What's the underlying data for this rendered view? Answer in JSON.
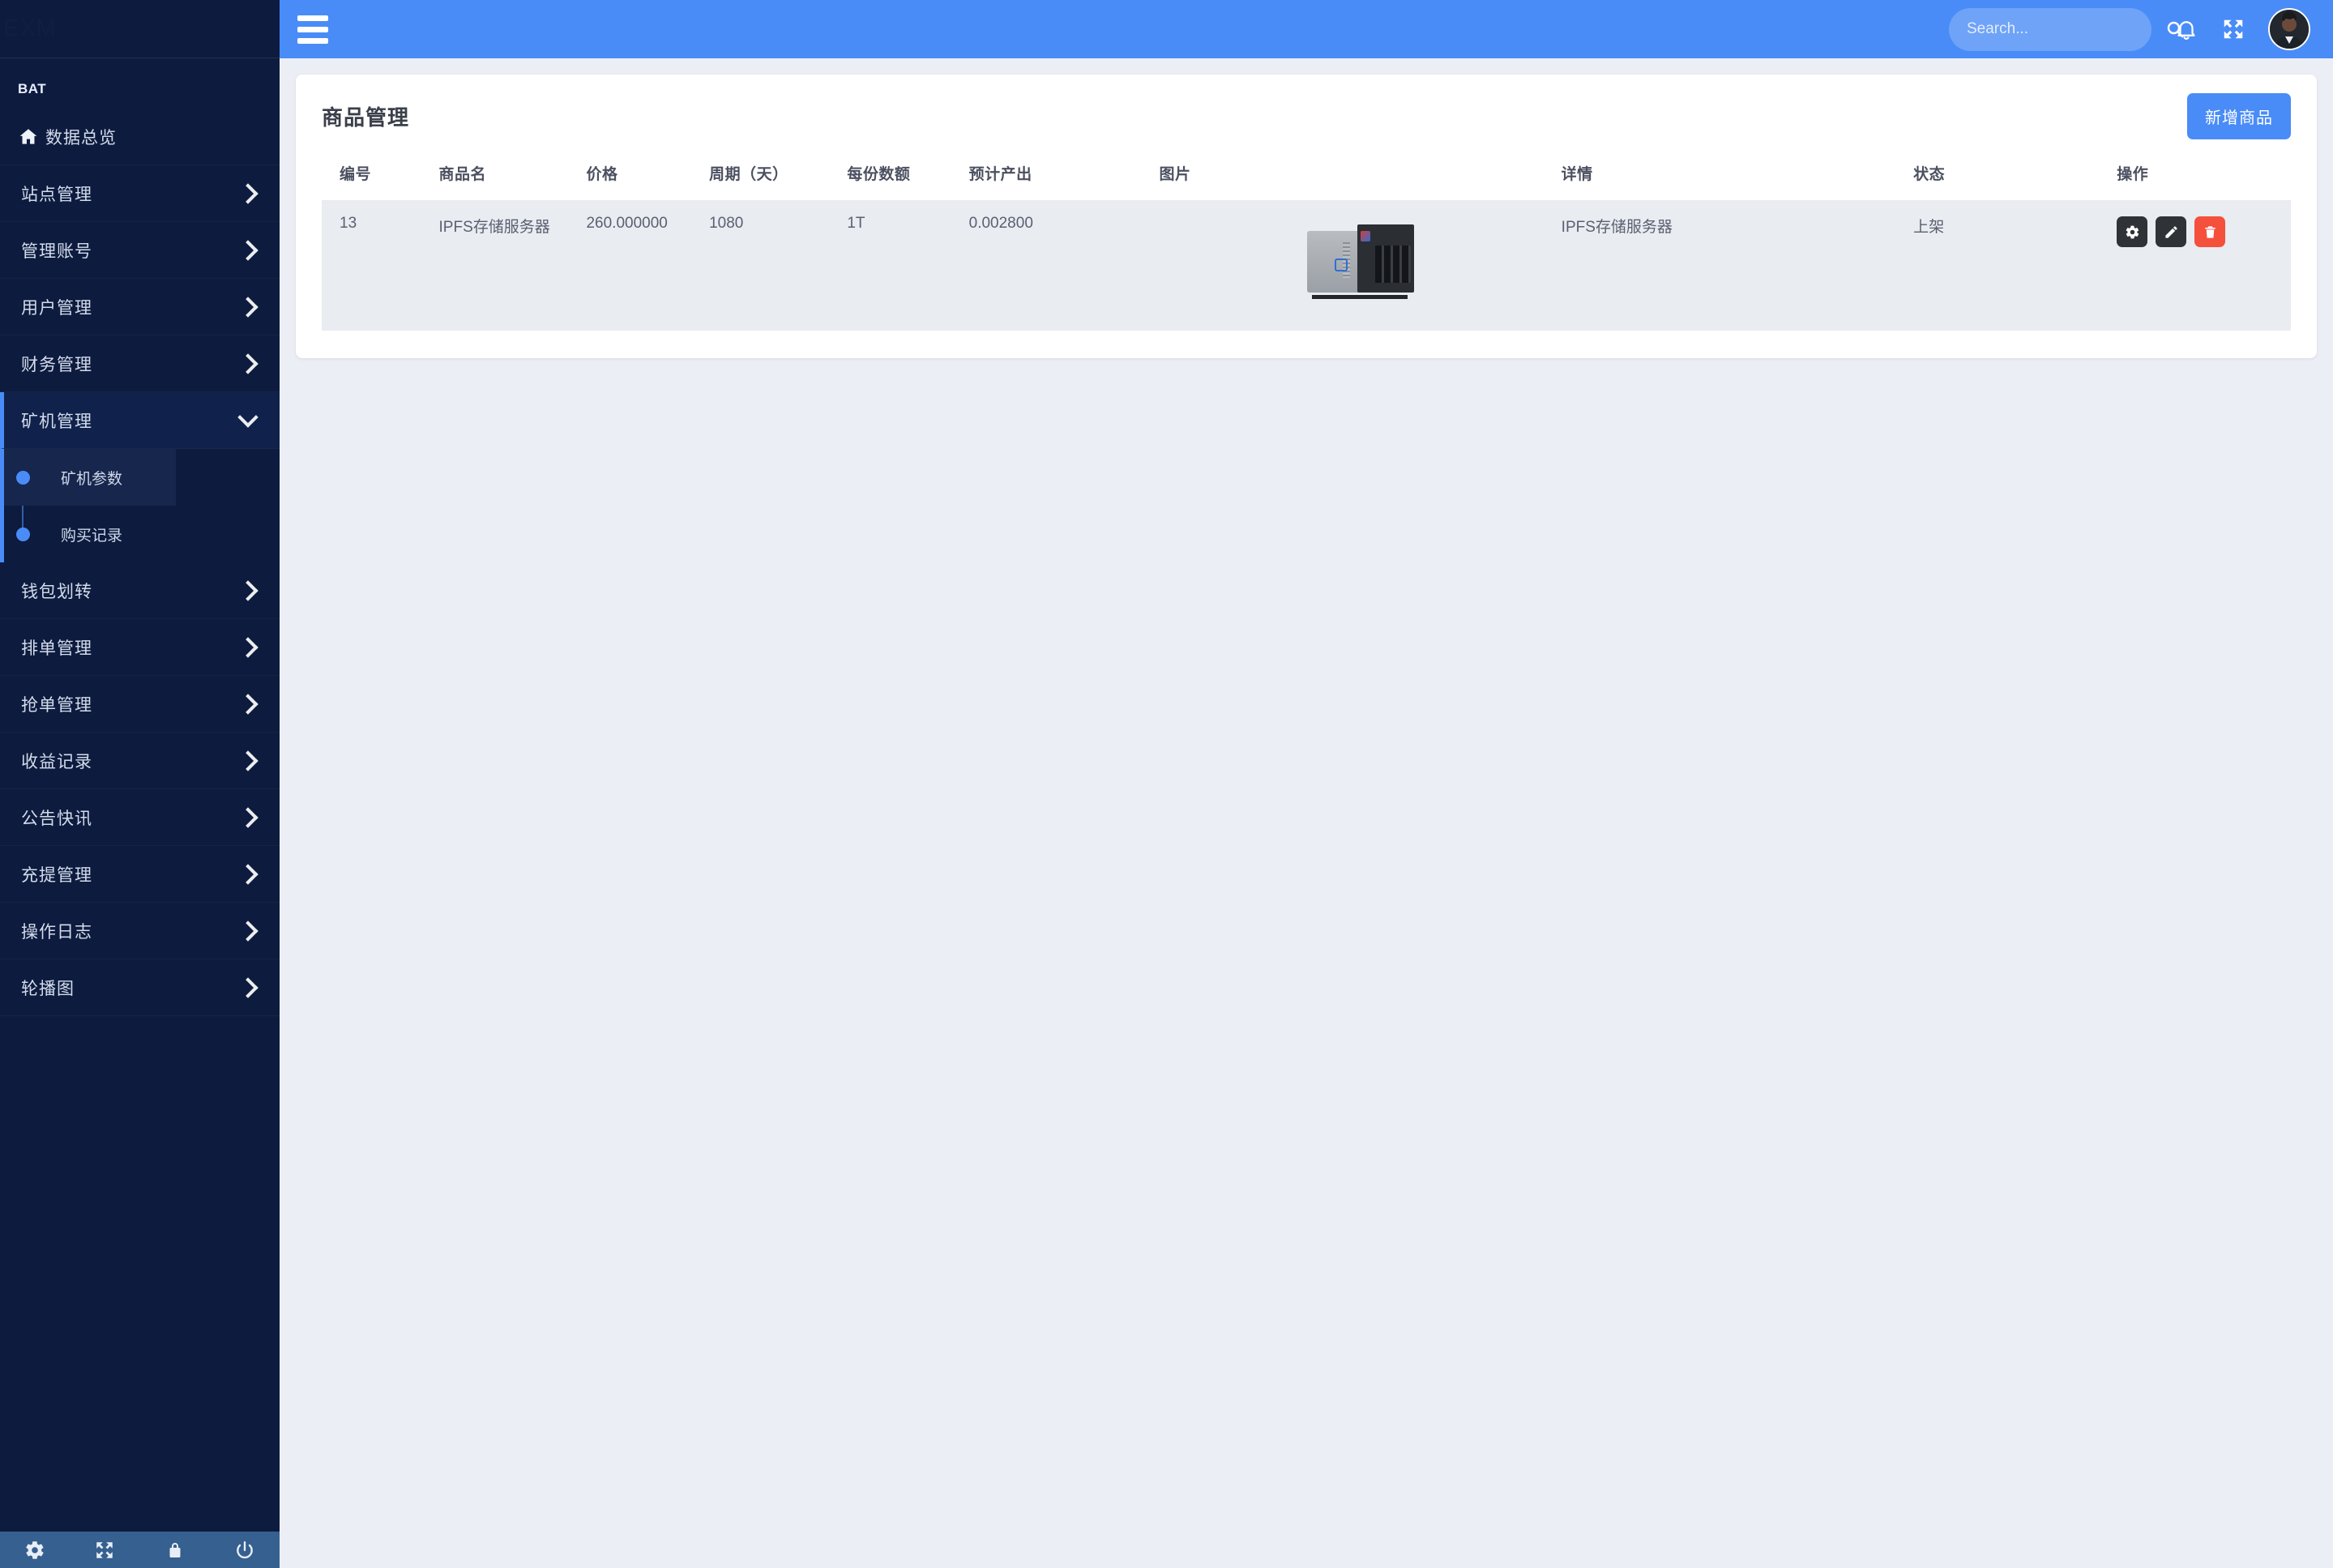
{
  "brand": {
    "logo_text": "EXM",
    "section_title": "BAT"
  },
  "sidebar": {
    "items": [
      {
        "label": "数据总览",
        "icon": "home-icon",
        "has_chevron": false,
        "state": "normal"
      },
      {
        "label": "站点管理",
        "icon": "chevron-right-icon",
        "has_chevron": true,
        "state": "normal"
      },
      {
        "label": "管理账号",
        "icon": "chevron-right-icon",
        "has_chevron": true,
        "state": "normal"
      },
      {
        "label": "用户管理",
        "icon": "chevron-right-icon",
        "has_chevron": true,
        "state": "normal"
      },
      {
        "label": "财务管理",
        "icon": "chevron-right-icon",
        "has_chevron": true,
        "state": "normal"
      },
      {
        "label": "矿机管理",
        "icon": "chevron-down-icon",
        "has_chevron": true,
        "state": "expanded"
      },
      {
        "label": "钱包划转",
        "icon": "chevron-right-icon",
        "has_chevron": true,
        "state": "normal"
      },
      {
        "label": "排单管理",
        "icon": "chevron-right-icon",
        "has_chevron": true,
        "state": "normal"
      },
      {
        "label": "抢单管理",
        "icon": "chevron-right-icon",
        "has_chevron": true,
        "state": "normal"
      },
      {
        "label": "收益记录",
        "icon": "chevron-right-icon",
        "has_chevron": true,
        "state": "normal"
      },
      {
        "label": "公告快讯",
        "icon": "chevron-right-icon",
        "has_chevron": true,
        "state": "normal"
      },
      {
        "label": "充提管理",
        "icon": "chevron-right-icon",
        "has_chevron": true,
        "state": "normal"
      },
      {
        "label": "操作日志",
        "icon": "chevron-right-icon",
        "has_chevron": true,
        "state": "normal"
      },
      {
        "label": "轮播图",
        "icon": "chevron-right-icon",
        "has_chevron": true,
        "state": "normal"
      }
    ],
    "submenu": [
      {
        "label": "矿机参数",
        "active": true
      },
      {
        "label": "购买记录",
        "active": false
      }
    ],
    "footer_icons": [
      "gear-icon",
      "expand-icon",
      "lock-icon",
      "power-icon"
    ]
  },
  "topbar": {
    "menu_icon": "hamburger-icon",
    "search": {
      "value": "",
      "placeholder": "Search..."
    },
    "search_icon": "search-icon",
    "bell_icon": "bell-icon",
    "expand_icon": "expand-icon",
    "avatar": "user-avatar"
  },
  "main": {
    "title": "商品管理",
    "add_button": "新增商品",
    "table": {
      "columns": [
        "编号",
        "商品名",
        "价格",
        "周期（天）",
        "每份数额",
        "预计产出",
        "图片",
        "详情",
        "状态",
        "操作"
      ],
      "rows": [
        {
          "id": "13",
          "name": "IPFS存储服务器",
          "price": "260.000000",
          "cycle": "1080",
          "share": "1T",
          "output": "0.002800",
          "image": "nas-server-photo",
          "detail": "IPFS存储服务器",
          "status": "上架",
          "ops": [
            "settings-icon",
            "edit-icon",
            "delete-icon"
          ]
        }
      ]
    }
  },
  "colors": {
    "sidebar_bg": "#0d1b3e",
    "topbar_blue": "#4a8cf7",
    "page_bg": "#eceef5",
    "row_bg": "#e9ecf1",
    "danger_red": "#f4503c",
    "dark_btn": "#2f3338"
  }
}
